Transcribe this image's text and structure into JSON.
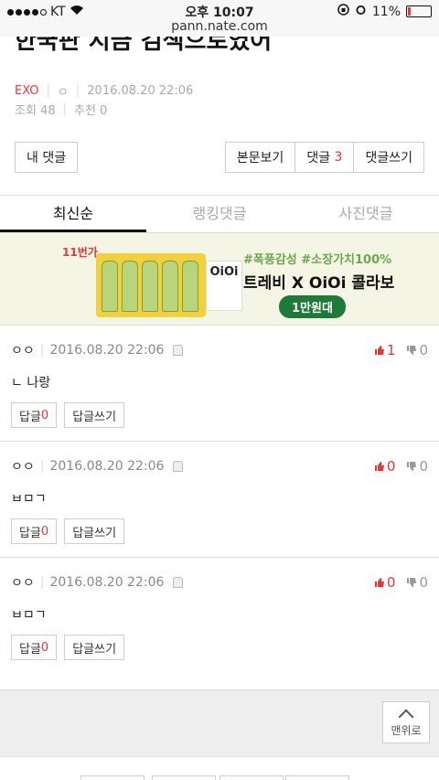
{
  "status_bar": {
    "carrier": "KT",
    "time": "오후 10:07",
    "url": "pann.nate.com",
    "battery": "11%",
    "battery_level": 0.11
  },
  "article": {
    "title_partial": "한국판 지금 검색으로였어",
    "author": "EXO",
    "author_extra": "ㅇ",
    "date": "2016.08.20 22:06",
    "views": "조회 48",
    "likes": "추천 0"
  },
  "actions": {
    "my_comments": "내 댓글",
    "view_body": "본문보기",
    "comments_label": "댓글",
    "comments_count": "3",
    "write_comment": "댓글쓰기"
  },
  "tabs": [
    {
      "label": "최신순",
      "active": true
    },
    {
      "label": "랭킹댓글",
      "active": false
    },
    {
      "label": "사진댓글",
      "active": false
    }
  ],
  "ad": {
    "badge": "11번가",
    "hashtags": "#폭풍감성 #소장가치100%",
    "title": "트레비 X OiOi 콜라보",
    "price": "1만원대",
    "bag_text": "OiOi"
  },
  "comments": [
    {
      "author": "ㅇㅇ",
      "date": "2016.08.20 22:06",
      "body": "ㄴ 나랑",
      "up": "1",
      "down": "0",
      "reply_label": "답글",
      "reply_count": "0",
      "write_reply": "답글쓰기"
    },
    {
      "author": "ㅇㅇ",
      "date": "2016.08.20 22:06",
      "body": "ㅂㅁㄱ",
      "up": "0",
      "down": "0",
      "reply_label": "답글",
      "reply_count": "0",
      "write_reply": "답글쓰기"
    },
    {
      "author": "ㅇㅇ",
      "date": "2016.08.20 22:06",
      "body": "ㅂㅁㄱ",
      "up": "0",
      "down": "0",
      "reply_label": "답글",
      "reply_count": "0",
      "write_reply": "답글쓰기"
    }
  ],
  "footer": {
    "top_button": "맨위로"
  }
}
